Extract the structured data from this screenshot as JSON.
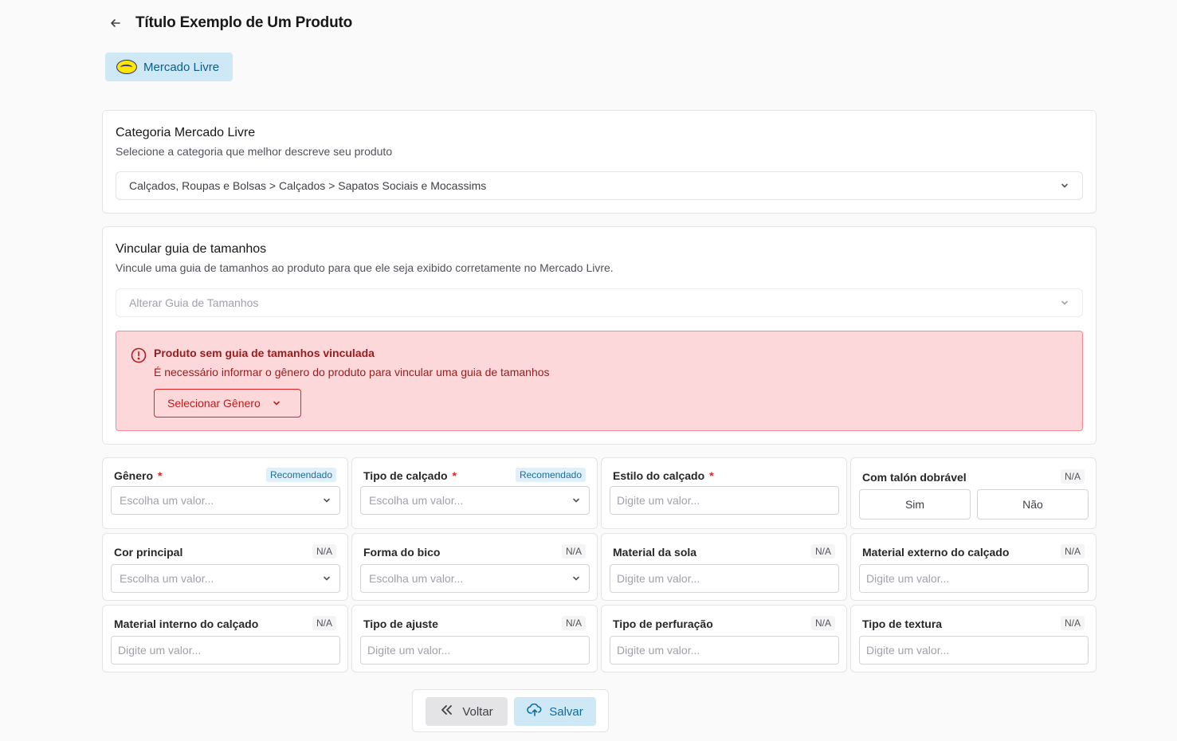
{
  "header": {
    "title": "Título Exemplo de Um Produto"
  },
  "marketplace": {
    "label": "Mercado Livre"
  },
  "category": {
    "title": "Categoria Mercado Livre",
    "description": "Selecione a categoria que melhor descreve seu produto",
    "selected": "Calçados, Roupas e Bolsas > Calçados > Sapatos Sociais e Mocassims"
  },
  "size_guide": {
    "title": "Vincular guia de tamanhos",
    "description": "Vincule uma guia de tamanhos ao produto para que ele seja exibido corretamente no Mercado Livre.",
    "placeholder": "Alterar Guia de Tamanhos",
    "alert": {
      "title": "Produto sem guia de tamanhos vinculada",
      "description": "É necessário informar o gênero do produto para vincular uma guia de tamanhos",
      "button": "Selecionar Gênero"
    }
  },
  "attributes": [
    {
      "label": "Gênero",
      "required": "*",
      "tag": "Recomendado",
      "placeholder": "Escolha um valor..."
    },
    {
      "label": "Tipo de calçado",
      "required": "*",
      "tag": "Recomendado",
      "placeholder": "Escolha um valor..."
    },
    {
      "label": "Estilo do calçado",
      "required": "*",
      "placeholder": "Digite um valor..."
    },
    {
      "label": "Com talón dobrável",
      "tag": "N/A",
      "yes": "Sim",
      "no": "Não"
    },
    {
      "label": "Cor principal",
      "tag": "N/A",
      "placeholder": "Escolha um valor..."
    },
    {
      "label": "Forma do bico",
      "tag": "N/A",
      "placeholder": "Escolha um valor..."
    },
    {
      "label": "Material da sola",
      "tag": "N/A",
      "placeholder": "Digite um valor..."
    },
    {
      "label": "Material externo do calçado",
      "tag": "N/A",
      "placeholder": "Digite um valor..."
    },
    {
      "label": "Material interno do calçado",
      "tag": "N/A",
      "placeholder": "Digite um valor..."
    },
    {
      "label": "Tipo de ajuste",
      "tag": "N/A",
      "placeholder": "Digite um valor..."
    },
    {
      "label": "Tipo de perfuração",
      "tag": "N/A",
      "placeholder": "Digite um valor..."
    },
    {
      "label": "Tipo de textura",
      "tag": "N/A",
      "placeholder": "Digite um valor..."
    }
  ],
  "footer": {
    "back_label": "Voltar",
    "save_label": "Salvar"
  }
}
